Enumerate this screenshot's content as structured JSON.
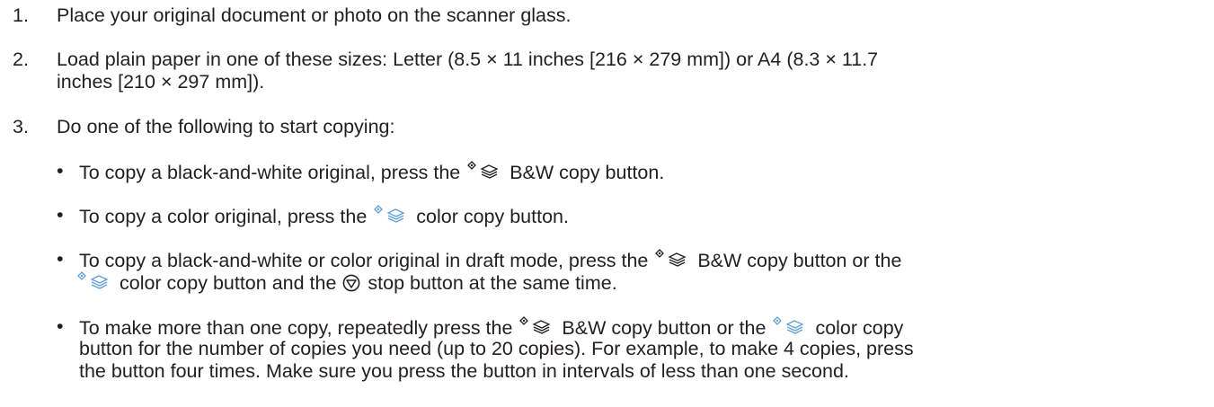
{
  "steps": [
    {
      "number": "1.",
      "text": "Place your original document or photo on the scanner glass."
    },
    {
      "number": "2.",
      "line1": "Load plain paper in one of these sizes: Letter (8.5 × 11 inches [216 × 279 mm]) or A4 (8.3 × 11.7",
      "line2": "inches [210 × 297 mm])."
    },
    {
      "number": "3.",
      "text": "Do one of the following to start copying:"
    }
  ],
  "bullet_symbol": "•",
  "bullets": [
    {
      "before": "To copy a black-and-white original, press the",
      "after": "B&W copy button."
    },
    {
      "before": "To copy a color original, press the",
      "after": "color copy button."
    },
    {
      "l1_before": "To copy a black-and-white or color original in draft mode, press the",
      "l1_after": "B&W copy button or the",
      "l2_mid": "color copy button and the",
      "l2_after": "stop button at the same time."
    },
    {
      "l1_before": "To make more than one copy, repeatedly press the",
      "l1_mid": "B&W copy button or the",
      "l1_after": "color copy",
      "l2": "button for the number of copies you need (up to 20 copies). For example, to make 4 copies, press",
      "l3": "the button four times. Make sure you press the button in intervals of less than one second."
    }
  ],
  "icons": {
    "bw_copy": "bw-copy-icon",
    "color_copy": "color-copy-icon",
    "stop": "stop-icon"
  }
}
